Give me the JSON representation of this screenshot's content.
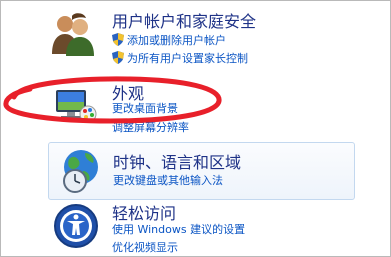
{
  "categories": [
    {
      "title": "用户帐户和家庭安全",
      "icon": "users-icon",
      "links": [
        {
          "label": "添加或删除用户帐户",
          "shield": true
        },
        {
          "label": "为所有用户设置家长控制",
          "shield": true
        }
      ]
    },
    {
      "title": "外观",
      "icon": "appearance-icon",
      "links": [
        {
          "label": "更改桌面背景",
          "shield": false
        },
        {
          "label": "调整屏幕分辨率",
          "shield": false
        }
      ]
    },
    {
      "title": "时钟、语言和区域",
      "icon": "globe-clock-icon",
      "links": [
        {
          "label": "更改键盘或其他输入法",
          "shield": false
        }
      ]
    },
    {
      "title": "轻松访问",
      "icon": "ease-of-access-icon",
      "links": [
        {
          "label": "使用 Windows 建议的设置",
          "shield": false
        },
        {
          "label": "优化视频显示",
          "shield": false
        }
      ]
    }
  ],
  "colors": {
    "title": "#1e3287",
    "link": "#0b55c4",
    "annotation": "#e8202a",
    "hover_border": "#c3d8ef"
  }
}
